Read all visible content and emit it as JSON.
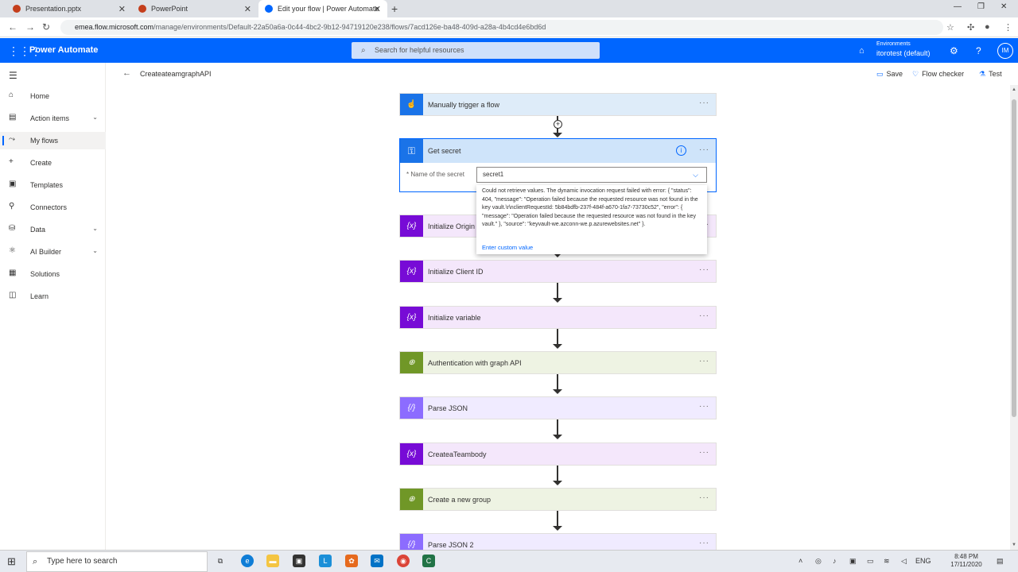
{
  "browser": {
    "tabs": [
      {
        "label": "Presentation.pptx",
        "color": "#c43e1c"
      },
      {
        "label": "PowerPoint",
        "color": "#c43e1c"
      },
      {
        "label": "Edit your flow | Power Automate",
        "color": "#0066ff"
      }
    ],
    "url_host": "emea.flow.microsoft.com",
    "url_path": "/manage/environments/Default-22a50a6a-0c44-4bc2-9b12-94719120e238/flows/7acd126e-ba48-409d-a28a-4b4cd4e6bd6d"
  },
  "appbar": {
    "brand": "Power Automate",
    "search_placeholder": "Search for helpful resources",
    "env_label": "Environments",
    "env_name": "itorotest (default)",
    "avatar": "IM",
    "color": "#0066ff"
  },
  "sidebar": {
    "items": [
      {
        "label": "Home",
        "icon": "home-icon"
      },
      {
        "label": "Action items",
        "icon": "clipboard-icon"
      },
      {
        "label": "My flows",
        "icon": "flow-icon"
      },
      {
        "label": "Create",
        "icon": "plus-icon"
      },
      {
        "label": "Templates",
        "icon": "templates-icon"
      },
      {
        "label": "Connectors",
        "icon": "plug-icon"
      },
      {
        "label": "Data",
        "icon": "database-icon"
      },
      {
        "label": "AI Builder",
        "icon": "ai-icon"
      },
      {
        "label": "Solutions",
        "icon": "solutions-icon"
      },
      {
        "label": "Learn",
        "icon": "book-icon"
      }
    ]
  },
  "cmdbar": {
    "flow_name": "CreateateamgraphAPI",
    "save": "Save",
    "flow_checker": "Flow checker",
    "test": "Test"
  },
  "flow": {
    "trigger": "Manually trigger a flow",
    "secret_title": "Get secret",
    "secret_field_label": "* Name of the secret",
    "secret_value": "secret1",
    "steps": [
      {
        "label": "Initialize Origin",
        "kind": "variable"
      },
      {
        "label": "Initialize Client ID",
        "kind": "variable"
      },
      {
        "label": "Initialize variable",
        "kind": "variable"
      },
      {
        "label": "Authentication with graph API",
        "kind": "http"
      },
      {
        "label": "Parse JSON",
        "kind": "json"
      },
      {
        "label": "CreateaTeambody",
        "kind": "variable"
      },
      {
        "label": "Create a new group",
        "kind": "http"
      },
      {
        "label": "Parse JSON 2",
        "kind": "json"
      }
    ],
    "colors": {
      "variable": "#770bd6",
      "http": "#709727",
      "json": "#8c6cff"
    }
  },
  "popup": {
    "error": "Could not retrieve values. The dynamic invocation request failed with error: { \"status\": 404, \"message\": \"Operation failed because the requested resource was not found in the key vault.\\r\\nclientRequestId: 5b84bdfb-237f-484f-a670-1fa7-73730c52\", \"error\": { \"message\": \"Operation failed because the requested resource was not found in the key vault.\" }, \"source\": \"keyvault-we.azconn-we.p.azurewebsites.net\" }.",
    "custom": "Enter custom value"
  },
  "taskbar": {
    "search_placeholder": "Type here to search",
    "lang": "ENG",
    "time": "8:48 PM",
    "date": "17/11/2020"
  }
}
